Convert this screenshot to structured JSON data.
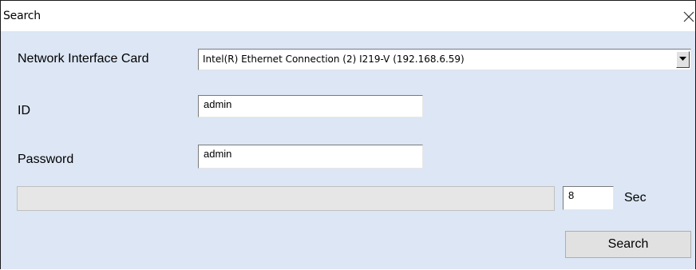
{
  "window": {
    "title": "Search",
    "close_icon": "close-icon"
  },
  "form": {
    "nic_label": "Network Interface Card",
    "nic_value": "Intel(R) Ethernet Connection (2) I219-V (192.168.6.59)",
    "nic_dropdown_icon": "chevron-down-icon",
    "id_label": "ID",
    "id_value": "admin",
    "password_label": "Password",
    "password_value": "admin"
  },
  "progress": {
    "fraction": 0
  },
  "timeout": {
    "value": "8",
    "unit": "Sec"
  },
  "actions": {
    "search_label": "Search"
  },
  "colors": {
    "dialog_background": "#dce6f4",
    "titlebar_background": "#ffffff",
    "button_face": "#e1e1e1",
    "progress_track": "#e6e6e6"
  }
}
